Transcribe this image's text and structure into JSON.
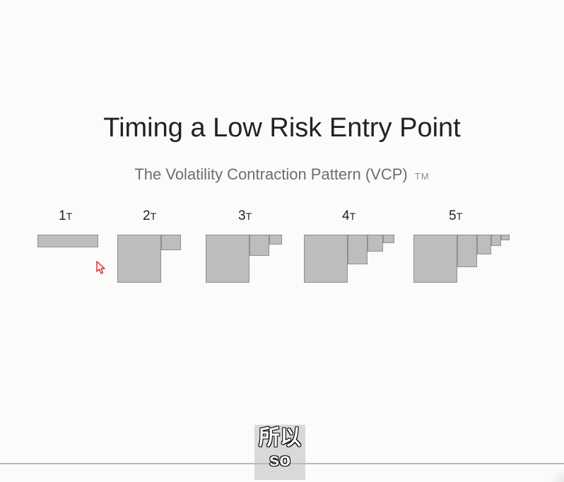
{
  "title": "Timing a Low Risk Entry Point",
  "subtitle": "The Volatility Contraction Pattern (VCP)",
  "subtitle_tm": "TM",
  "groups": [
    {
      "num": "1",
      "sub": "T",
      "bars": 1
    },
    {
      "num": "2",
      "sub": "T",
      "bars": 2
    },
    {
      "num": "3",
      "sub": "T",
      "bars": 3
    },
    {
      "num": "4",
      "sub": "T",
      "bars": 4
    },
    {
      "num": "5",
      "sub": "T",
      "bars": 5
    }
  ],
  "caption": {
    "cn": "所以",
    "en": "so"
  },
  "colors": {
    "bar_fill": "#bdbdbd",
    "bar_border": "#8e8e8e",
    "bg": "#fbfbfa",
    "text": "#222",
    "subtext": "#6d6d6d"
  }
}
